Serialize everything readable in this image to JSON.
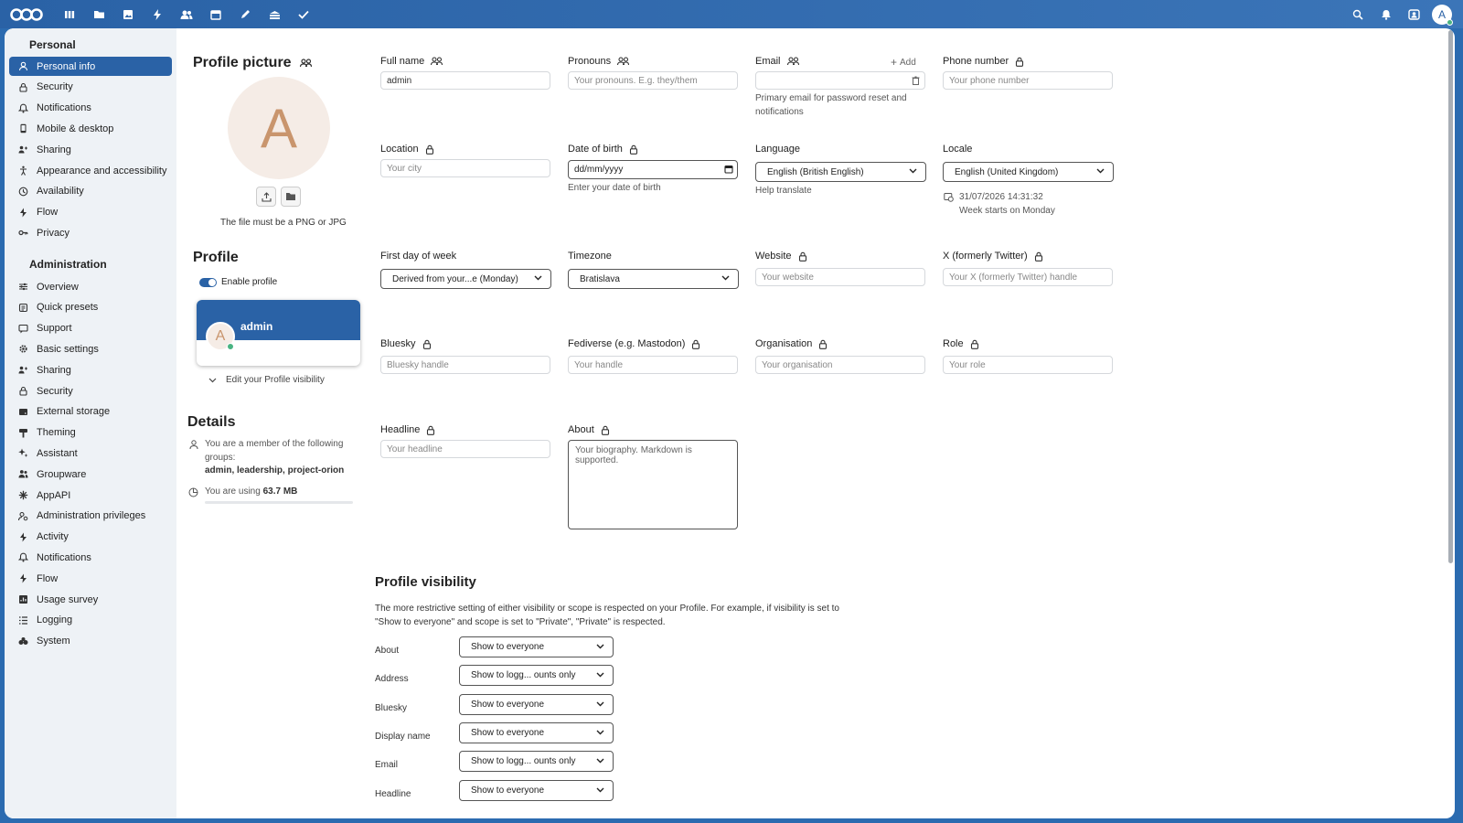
{
  "header": {
    "apps": [
      "dashboard-icon",
      "files-icon",
      "photos-icon",
      "activity-icon",
      "contacts-icon",
      "calendar-icon",
      "notes-icon",
      "deck-icon",
      "tasks-icon"
    ],
    "right_icons": [
      "search-icon",
      "notifications-icon",
      "contacts-menu-icon"
    ],
    "avatar_letter": "A"
  },
  "sidebar": {
    "personal_caption": "Personal",
    "personal_items": [
      {
        "label": "Personal info",
        "icon": "person-icon"
      },
      {
        "label": "Security",
        "icon": "lock-icon"
      },
      {
        "label": "Notifications",
        "icon": "bell-icon"
      },
      {
        "label": "Mobile & desktop",
        "icon": "phone-icon"
      },
      {
        "label": "Sharing",
        "icon": "share-icon"
      },
      {
        "label": "Appearance and accessibility",
        "icon": "accessibility-icon"
      },
      {
        "label": "Availability",
        "icon": "clock-icon"
      },
      {
        "label": "Flow",
        "icon": "flow-icon"
      },
      {
        "label": "Privacy",
        "icon": "key-icon"
      }
    ],
    "admin_caption": "Administration",
    "admin_items": [
      {
        "label": "Overview",
        "icon": "sliders-icon"
      },
      {
        "label": "Quick presets",
        "icon": "presets-icon"
      },
      {
        "label": "Support",
        "icon": "support-icon"
      },
      {
        "label": "Basic settings",
        "icon": "gear-icon"
      },
      {
        "label": "Sharing",
        "icon": "share-icon"
      },
      {
        "label": "Security",
        "icon": "lock-icon"
      },
      {
        "label": "External storage",
        "icon": "storage-icon"
      },
      {
        "label": "Theming",
        "icon": "paint-icon"
      },
      {
        "label": "Assistant",
        "icon": "sparkle-icon"
      },
      {
        "label": "Groupware",
        "icon": "groupware-icon"
      },
      {
        "label": "AppAPI",
        "icon": "api-icon"
      },
      {
        "label": "Administration privileges",
        "icon": "privileges-icon"
      },
      {
        "label": "Activity",
        "icon": "activity-icon"
      },
      {
        "label": "Notifications",
        "icon": "bell-icon"
      },
      {
        "label": "Flow",
        "icon": "flow-icon"
      },
      {
        "label": "Usage survey",
        "icon": "survey-icon"
      },
      {
        "label": "Logging",
        "icon": "list-icon"
      },
      {
        "label": "System",
        "icon": "system-icon"
      }
    ]
  },
  "profile_picture": {
    "title": "Profile picture",
    "avatar_letter": "A",
    "note": "The file must be a PNG or JPG"
  },
  "profile": {
    "title": "Profile",
    "enable_label": "Enable profile",
    "card_name": "admin",
    "card_avatar_letter": "A",
    "edit_visibility": "Edit your Profile visibility"
  },
  "details": {
    "title": "Details",
    "groups_text": "You are a member of the following groups:",
    "groups": "admin, leadership, project-orion",
    "usage_prefix": "You are using",
    "usage_value": "63.7 MB"
  },
  "fields": {
    "full_name": {
      "label": "Full name",
      "value": "admin"
    },
    "pronouns": {
      "label": "Pronouns",
      "placeholder": "Your pronouns. E.g. they/them"
    },
    "email": {
      "label": "Email",
      "add": "Add",
      "hint": "Primary email for password reset and notifications"
    },
    "phone": {
      "label": "Phone number",
      "placeholder": "Your phone number"
    },
    "location": {
      "label": "Location",
      "placeholder": "Your city"
    },
    "dob": {
      "label": "Date of birth",
      "placeholder": "dd/mm/yyyy",
      "hint": "Enter your date of birth"
    },
    "language": {
      "label": "Language",
      "value": "English (British English)",
      "hint": "Help translate"
    },
    "locale": {
      "label": "Locale",
      "value": "English (United Kingdom)",
      "time": "31/07/2026 14:31:32",
      "week": "Week starts on Monday"
    },
    "first_day": {
      "label": "First day of week",
      "value": "Derived from your...e (Monday)"
    },
    "timezone": {
      "label": "Timezone",
      "value": "Bratislava"
    },
    "website": {
      "label": "Website",
      "placeholder": "Your website"
    },
    "twitter": {
      "label": "X (formerly Twitter)",
      "placeholder": "Your X (formerly Twitter) handle"
    },
    "bluesky": {
      "label": "Bluesky",
      "placeholder": "Bluesky handle"
    },
    "fediverse": {
      "label": "Fediverse (e.g. Mastodon)",
      "placeholder": "Your handle"
    },
    "organisation": {
      "label": "Organisation",
      "placeholder": "Your organisation"
    },
    "role": {
      "label": "Role",
      "placeholder": "Your role"
    },
    "headline": {
      "label": "Headline",
      "placeholder": "Your headline"
    },
    "about": {
      "label": "About",
      "placeholder": "Your biography. Markdown is supported."
    }
  },
  "visibility": {
    "title": "Profile visibility",
    "description": "The more restrictive setting of either visibility or scope is respected on your Profile. For example, if visibility is set to \"Show to everyone\" and scope is set to \"Private\", \"Private\" is respected.",
    "rows": [
      {
        "label": "About",
        "value": "Show to everyone"
      },
      {
        "label": "Address",
        "value": "Show to logg... ounts only"
      },
      {
        "label": "Bluesky",
        "value": "Show to everyone"
      },
      {
        "label": "Display name",
        "value": "Show to everyone"
      },
      {
        "label": "Email",
        "value": "Show to logg... ounts only"
      },
      {
        "label": "Headline",
        "value": "Show to everyone"
      }
    ]
  },
  "colors": {
    "primary": "#2a62a6",
    "online": "#49b382",
    "avatar_bg": "#f5ece6",
    "avatar_fg": "#c9956d"
  }
}
